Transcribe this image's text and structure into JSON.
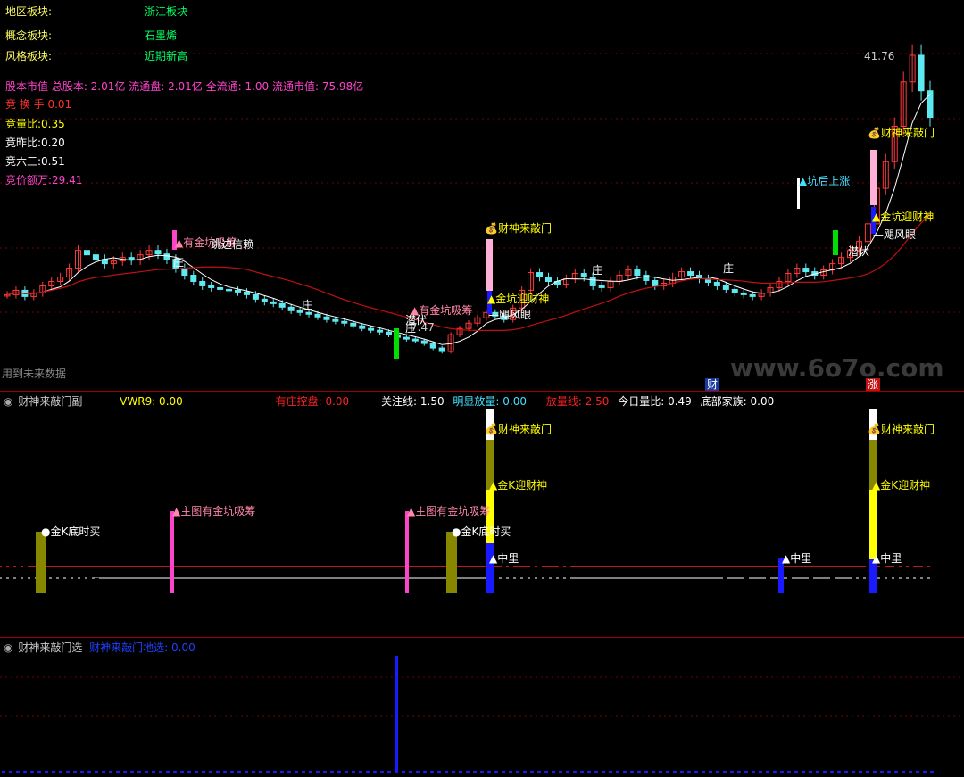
{
  "colors": {
    "up_candle": "#ff3b3b",
    "down_candle": "#5ee8f0",
    "ma_short": "#ffffff",
    "ma_long": "#c01010",
    "magenta": "#ff44cc",
    "yellow": "#ffff00",
    "olive": "#888800",
    "blue": "#1a1aff",
    "green": "#00dd00",
    "red": "#ff0000",
    "grid": "#7a0000"
  },
  "info_lines": [
    {
      "label": "地区板块:",
      "value": "浙江板块"
    },
    {
      "label": "概念板块:",
      "value": "石墨烯"
    },
    {
      "label": "风格板块:",
      "value": "近期新高"
    }
  ],
  "stock_caps": "股本市值 总股本: 2.01亿 流通盘: 2.01亿 全流通: 1.00 流通市值: 75.98亿",
  "auction": [
    {
      "text": "竞 换 手 0.01",
      "color": "#ff3030"
    },
    {
      "text": "竞量比:0.35",
      "color": "#ffff00"
    },
    {
      "text": "竞昨比:0.20",
      "color": "#ffffff"
    },
    {
      "text": "竞六三:0.51",
      "color": "#ffffff"
    },
    {
      "text": "竞价额万:29.41",
      "color": "#ff44cc"
    }
  ],
  "main_panel": {
    "future_data_note": "用到未来数据",
    "high_price_label": "41.76",
    "low_price_label": "7.47",
    "watermark": "www.6o7o.com",
    "bottom_mark_cai": "财",
    "bottom_mark_zhang": "涨",
    "annotations": {
      "zhuang": "庄",
      "jinkeng_xichou": "有金坑吸筹",
      "diao_xinlai": "跳边信赖",
      "caishen_jiaomen": "财神来敲门",
      "jinkeng_yingcaishen": "金坑迎财神",
      "jufeng_yan": "飓风眼",
      "qianfu": "潜伏",
      "kenghou_shangzhang": "坑后上涨"
    }
  },
  "indicator_panel": {
    "title": "财神来敲门副",
    "items": [
      {
        "text": "VWR9: 0.00",
        "color": "#ffff00"
      },
      {
        "text": "有庄控盘: 0.00",
        "color": "#ff2020"
      },
      {
        "text": "关注线: 1.50",
        "color": "#ffffff"
      },
      {
        "text": "明显放量: 0.00",
        "color": "#40e0ff"
      },
      {
        "text": "放量线: 2.50",
        "color": "#ff2020"
      },
      {
        "text": "今日量比: 0.49",
        "color": "#ffffff"
      },
      {
        "text": "底部家族: 0.00",
        "color": "#ffffff"
      }
    ],
    "annotations": {
      "jinK_dishimai": "金K底时买",
      "zhutu_jinkeng": "主图有金坑吸筹",
      "caishen_jiaomen": "财神来敲门",
      "jinK_yingcaishen": "金K迎财神",
      "zhongli": "中里"
    }
  },
  "filter_panel": {
    "title": "财神来敲门选",
    "item": "财神来敲门地选: 0.00"
  },
  "chart_data": {
    "type": "candlestick",
    "price_high_marked": 41.76,
    "price_low_marked": 7.47,
    "candles_note": "approximate price series shape read from chart",
    "close_series": [
      14,
      14.5,
      13.8,
      14.2,
      15,
      15.5,
      16,
      17,
      19,
      18.5,
      18,
      17.5,
      17.8,
      18.2,
      17.9,
      18.5,
      19,
      18.6,
      18,
      17,
      16.2,
      15.5,
      15,
      14.8,
      14.6,
      14.5,
      14.3,
      14,
      13.5,
      13.2,
      13,
      12.6,
      12.2,
      12,
      11.8,
      11.5,
      11.2,
      11,
      10.8,
      10.5,
      10.2,
      10,
      9.8,
      9.5,
      9.2,
      9,
      8.8,
      8.5,
      8,
      7.6,
      9.5,
      10.2,
      10.8,
      11.4,
      12,
      11.6,
      11.2,
      12.5,
      14.5,
      16.5,
      16,
      15.5,
      15.2,
      15.8,
      16.4,
      16,
      15,
      14.8,
      15.5,
      16.2,
      16.8,
      16.2,
      15.6,
      15,
      15.3,
      16,
      16.6,
      16.2,
      15.8,
      15.4,
      15,
      14.6,
      14.2,
      14,
      13.8,
      14.2,
      14.8,
      15.5,
      16.4,
      17,
      16.6,
      16.2,
      16.8,
      17.5,
      18.2,
      19,
      20,
      22,
      26,
      29,
      33,
      38,
      41,
      37,
      34
    ]
  }
}
